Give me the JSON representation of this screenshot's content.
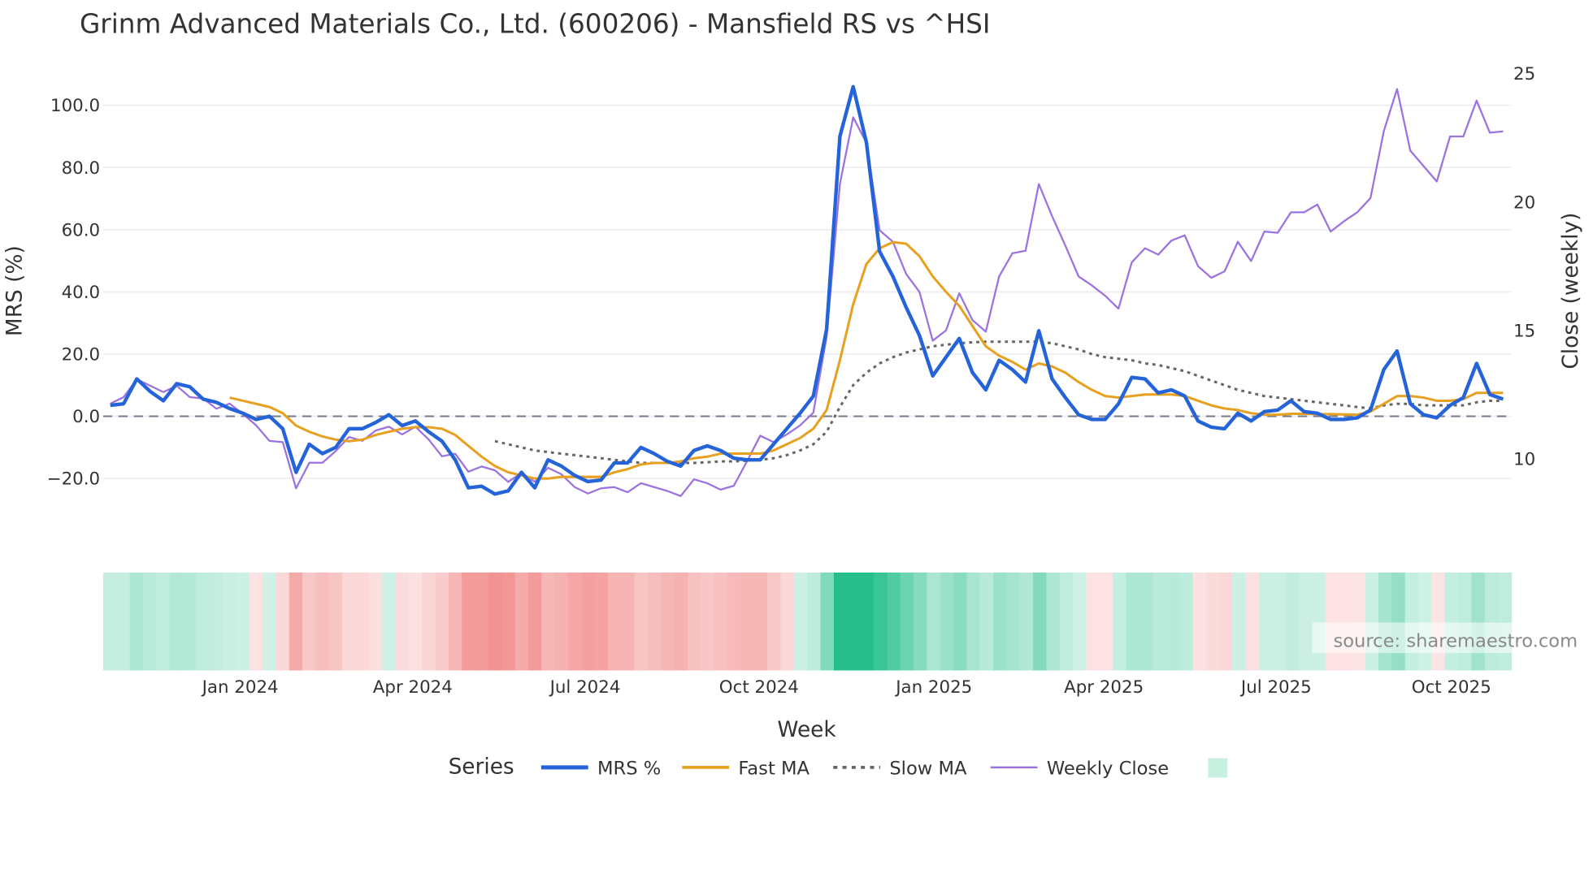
{
  "chart_data": {
    "type": "line",
    "title": "Grinm Advanced Materials Co., Ltd. (600206) - Mansfield RS vs ^HSI",
    "xlabel": "Week",
    "ylabel": "MRS (%)",
    "y2label": "Close (weekly)",
    "ylim": [
      -33.5,
      113.5
    ],
    "y2lim": [
      7.6,
      25.4
    ],
    "yticks": [
      "100.0",
      "80.0",
      "60.0",
      "40.0",
      "20.0",
      "0.0",
      "−20.0"
    ],
    "ytick_values": [
      100,
      80,
      60,
      40,
      20,
      0,
      -20
    ],
    "y2ticks": [
      "25",
      "20",
      "15",
      "10"
    ],
    "y2tick_values": [
      25,
      20,
      15,
      10
    ],
    "xticks": [
      "Jan 2024",
      "Apr 2024",
      "Jul 2024",
      "Oct 2024",
      "Jan 2025",
      "Apr 2025",
      "Jul 2025",
      "Oct 2025"
    ],
    "xtick_week_index": [
      9.8,
      22.8,
      35.8,
      48.9,
      62.1,
      74.9,
      87.9,
      101.1
    ],
    "week_count": 106,
    "grid": true,
    "zero_line": true,
    "legend": {
      "title": "Series",
      "placement": "bottom-center"
    },
    "series": [
      {
        "name": "MRS %",
        "color": "#2563d9",
        "style": "solid",
        "start_index": 0,
        "values": [
          3.5,
          4,
          12,
          8,
          5,
          10.5,
          9.5,
          5.5,
          4.5,
          2.5,
          1,
          -1,
          0,
          -4,
          -18,
          -9,
          -12,
          -10,
          -4,
          -4,
          -2,
          0.5,
          -3,
          -1.5,
          -5,
          -8,
          -14,
          -23,
          -22.5,
          -25,
          -24,
          -18,
          -23,
          -14,
          -16,
          -19,
          -21,
          -20.5,
          -15,
          -15,
          -10,
          -12,
          -14.5,
          -16,
          -11,
          -9.5,
          -11,
          -13.5,
          -14,
          -14,
          -9,
          -4,
          1,
          6.5,
          28,
          90,
          106,
          88,
          53,
          45,
          35,
          26,
          13,
          19,
          25,
          14,
          8.5,
          18,
          15,
          11,
          27.5,
          12,
          6,
          0.5,
          -1,
          -1,
          4,
          12.5,
          12,
          7.5,
          8.5,
          6.5,
          -1.5,
          -3.5,
          -4,
          1,
          -1.5,
          1.5,
          2,
          5,
          1.5,
          1,
          -1,
          -1,
          -0.5,
          2,
          15,
          21,
          4,
          0.5,
          -0.5,
          3.5,
          6,
          17,
          7,
          5.5
        ]
      },
      {
        "name": "Fast MA",
        "color": "#e8a020",
        "style": "solid",
        "start_index": 9,
        "values": [
          6,
          5,
          4,
          3,
          1,
          -3,
          -5,
          -6.5,
          -7.5,
          -8,
          -7.5,
          -6,
          -5,
          -4,
          -3.5,
          -3.5,
          -4,
          -6,
          -9.5,
          -13,
          -16,
          -18,
          -19,
          -20,
          -20,
          -19.5,
          -19.5,
          -19.5,
          -19.5,
          -18,
          -17,
          -15.5,
          -15,
          -15,
          -14.5,
          -13.5,
          -13,
          -12,
          -12,
          -12,
          -12,
          -11,
          -9,
          -7,
          -4,
          2,
          18,
          36,
          49,
          54,
          56,
          55.5,
          51.5,
          45,
          40,
          35.5,
          29,
          22.5,
          19.5,
          17.5,
          15,
          17,
          16,
          14,
          11,
          8.5,
          6.5,
          6,
          6.5,
          7,
          7,
          7,
          6.5,
          5,
          3.5,
          2.5,
          2,
          1,
          0.5,
          0.5,
          0.8,
          0.8,
          0.7,
          0.7,
          0.6,
          0.5,
          1.5,
          4,
          6.5,
          6.5,
          6,
          5,
          5,
          5.5,
          7.5,
          7.5,
          7.5
        ]
      },
      {
        "name": "Slow MA",
        "color": "#666666",
        "style": "dot",
        "start_index": 29,
        "values": [
          -8,
          -9,
          -10,
          -11,
          -11.5,
          -12,
          -12.5,
          -13,
          -13.5,
          -14,
          -14.5,
          -15,
          -15,
          -15,
          -15,
          -15,
          -14.8,
          -14.5,
          -14.5,
          -14.3,
          -14,
          -13.5,
          -12.5,
          -11,
          -9,
          -5,
          3,
          10,
          14,
          17,
          19,
          20.5,
          21.5,
          22.5,
          23,
          23.5,
          23.8,
          24,
          24,
          24,
          24,
          24,
          23.5,
          22.5,
          21.5,
          20,
          19,
          18.5,
          18,
          17,
          16.5,
          15.5,
          14.5,
          13,
          11.5,
          10,
          8.5,
          7.5,
          6.5,
          6,
          5.5,
          5,
          4.5,
          4,
          3.5,
          3,
          2.5,
          3.5,
          4,
          4,
          3.5,
          3.5,
          3.5,
          3.5,
          4.5,
          5,
          5
        ]
      },
      {
        "name": "Weekly Close",
        "color": "#9b72e0",
        "style": "solid",
        "axis": "y2",
        "start_index": 0,
        "values": [
          12.15,
          12.4,
          13.1,
          12.85,
          12.6,
          12.85,
          12.4,
          12.35,
          11.95,
          12.15,
          11.75,
          11.3,
          10.7,
          10.65,
          8.85,
          9.85,
          9.85,
          10.3,
          10.85,
          10.7,
          11.1,
          11.25,
          10.95,
          11.25,
          10.75,
          10.1,
          10.2,
          9.5,
          9.7,
          9.55,
          9.1,
          9.45,
          9.1,
          9.65,
          9.4,
          8.9,
          8.65,
          8.85,
          8.9,
          8.7,
          9.05,
          8.9,
          8.75,
          8.55,
          9.2,
          9.05,
          8.8,
          8.95,
          9.9,
          10.9,
          10.65,
          10.95,
          11.3,
          11.8,
          14.75,
          20.7,
          23.3,
          22.3,
          18.9,
          18.45,
          17.2,
          16.5,
          14.6,
          15,
          16.45,
          15.4,
          14.95,
          17.1,
          18,
          18.1,
          20.7,
          19.45,
          18.3,
          17.1,
          16.75,
          16.35,
          15.85,
          17.65,
          18.2,
          17.95,
          18.5,
          18.7,
          17.5,
          17.05,
          17.3,
          18.45,
          17.7,
          18.85,
          18.8,
          19.6,
          19.6,
          19.9,
          18.85,
          19.25,
          19.6,
          20.15,
          22.75,
          24.4,
          22,
          21.4,
          20.8,
          22.55,
          22.55,
          23.95,
          22.7,
          22.75
        ]
      }
    ],
    "heatmap": {
      "name": "MRS heat strip",
      "positive_color": "#26bf8c",
      "negative_color": "#f08080",
      "legend_swatch": "#c8f0e0"
    }
  },
  "watermark": "source: sharemaestro.com"
}
